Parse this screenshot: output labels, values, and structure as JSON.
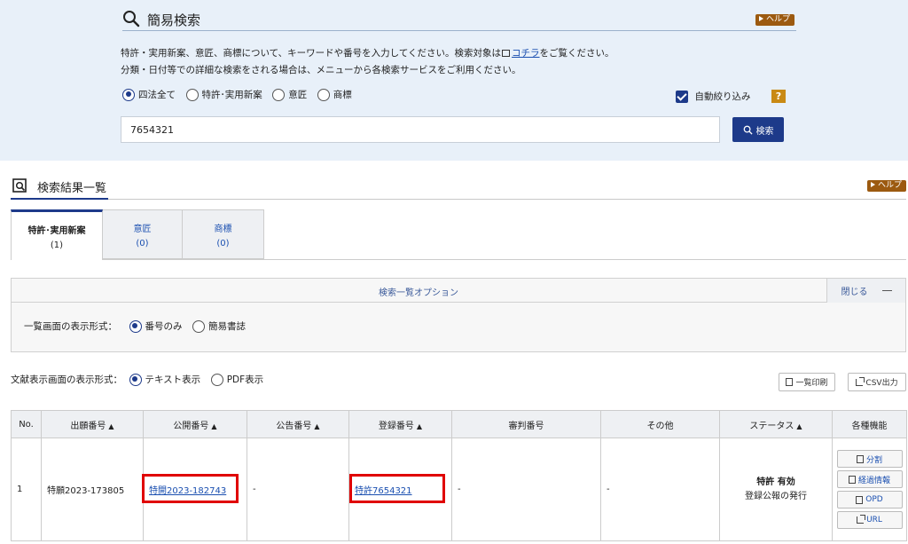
{
  "simple_search": {
    "title": "簡易検索",
    "help_label": "ヘルプ",
    "description_line1_before": "特許・実用新案、意匠、商標について、キーワードや番号を入力してください。検索対象は",
    "description_line1_link": "コチラ",
    "description_line1_after": "をご覧ください。",
    "description_line2": "分類・日付等での詳細な検索をされる場合は、メニューから各検索サービスをご利用ください。",
    "law_options": [
      {
        "label": "四法全て",
        "selected": true
      },
      {
        "label": "特許･実用新案",
        "selected": false
      },
      {
        "label": "意匠",
        "selected": false
      },
      {
        "label": "商標",
        "selected": false
      }
    ],
    "auto_narrow_label": "自動絞り込み",
    "auto_narrow_checked": true,
    "question_badge": "?",
    "input_value": "7654321",
    "search_button_label": "検索"
  },
  "results": {
    "title": "検索結果一覧",
    "help_label": "ヘルプ",
    "tabs": [
      {
        "label": "特許･実用新案",
        "count": "(1)",
        "active": true
      },
      {
        "label": "意匠",
        "count": "(0)",
        "active": false
      },
      {
        "label": "商標",
        "count": "(0)",
        "active": false
      }
    ],
    "options": {
      "title": "検索一覧オプション",
      "close_label": "閉じる",
      "list_format_label": "一覧画面の表示形式：",
      "list_format_options": [
        {
          "label": "番号のみ",
          "selected": true
        },
        {
          "label": "簡易書誌",
          "selected": false
        }
      ]
    },
    "doc_format_label": "文献表示画面の表示形式：",
    "doc_format_options": [
      {
        "label": "テキスト表示",
        "selected": true
      },
      {
        "label": "PDF表示",
        "selected": false
      }
    ],
    "print_list_label": "一覧印刷",
    "csv_label": "CSV出力",
    "table": {
      "headers": [
        "No.",
        "出願番号",
        "公開番号",
        "公告番号",
        "登録番号",
        "審判番号",
        "その他",
        "ステータス",
        "各種機能"
      ],
      "sort_marks": [
        "",
        "▲",
        "▲",
        "▲",
        "▲",
        "",
        "",
        "▲",
        ""
      ],
      "rows": [
        {
          "no": "1",
          "application": "特願2023-173805",
          "publication": "特開2023-182743",
          "announcement": "-",
          "registration": "特許7654321",
          "trial": "-",
          "other": "-",
          "status_main": "特許 有効",
          "status_sub": "登録公報の発行",
          "functions": [
            "分割",
            "経過情報",
            "OPD",
            "URL"
          ]
        }
      ]
    }
  },
  "colors": {
    "panel_bg": "#e8f0f9",
    "primary": "#1d3a8a",
    "help_badge": "#9c5a10",
    "highlight_box": "#e00000",
    "link": "#1a4fb0"
  }
}
